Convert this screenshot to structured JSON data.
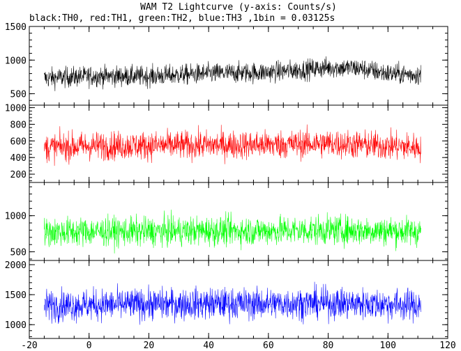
{
  "title": "WAM T2 Lightcurve (y-axis: Counts/s)",
  "subtitle": "black:TH0, red:TH1, green:TH2, blue:TH3 ,1bin = 0.03125s",
  "chart_data": {
    "type": "line",
    "title": "WAM T2 Lightcurve (y-axis: Counts/s)",
    "subtitle": "black:TH0, red:TH1, green:TH2, blue:TH3 ,1bin = 0.03125s",
    "xlim": [
      -20,
      120
    ],
    "x_ticks": [
      -20,
      0,
      20,
      40,
      60,
      80,
      100,
      120
    ],
    "x_ticklabels": [
      "-20",
      "0",
      "20",
      "40",
      "60",
      "80",
      "100",
      "120"
    ],
    "x_range": [
      -15,
      111
    ],
    "bin_width": 0.03125,
    "grid": false,
    "panels": [
      {
        "name": "TH0",
        "color": "#000000",
        "ylim": [
          330,
          1500
        ],
        "yticks": [
          500,
          1000,
          1500
        ],
        "yticklabels": [
          "500",
          "1000",
          "1500"
        ],
        "baseline_x": [
          -15,
          0,
          20,
          40,
          60,
          70,
          80,
          90,
          100,
          111
        ],
        "baseline_y": [
          730,
          760,
          760,
          800,
          820,
          850,
          890,
          880,
          800,
          780
        ],
        "band_halfwidth": 150
      },
      {
        "name": "TH1",
        "color": "#ff0000",
        "ylim": [
          100,
          1030
        ],
        "yticks": [
          200,
          400,
          600,
          800,
          1000
        ],
        "yticklabels": [
          "200",
          "400",
          "600",
          "800",
          "1000"
        ],
        "baseline_x": [
          -15,
          0,
          20,
          40,
          60,
          80,
          100,
          111
        ],
        "baseline_y": [
          520,
          540,
          545,
          550,
          555,
          570,
          540,
          520
        ],
        "band_halfwidth": 170
      },
      {
        "name": "TH2",
        "color": "#00ff00",
        "ylim": [
          380,
          1460
        ],
        "yticks": [
          500,
          1000
        ],
        "yticklabels": [
          "500",
          "1000"
        ],
        "baseline_x": [
          -15,
          0,
          20,
          40,
          60,
          80,
          100,
          111
        ],
        "baseline_y": [
          770,
          780,
          780,
          790,
          790,
          800,
          790,
          780
        ],
        "band_halfwidth": 200
      },
      {
        "name": "TH3",
        "color": "#0000ff",
        "ylim": [
          770,
          2070
        ],
        "yticks": [
          1000,
          1500,
          2000
        ],
        "yticklabels": [
          "1000",
          "1500",
          "2000"
        ],
        "baseline_x": [
          -15,
          0,
          20,
          40,
          60,
          80,
          100,
          111
        ],
        "baseline_y": [
          1320,
          1330,
          1340,
          1350,
          1350,
          1360,
          1340,
          1320
        ],
        "band_halfwidth": 260
      }
    ]
  }
}
